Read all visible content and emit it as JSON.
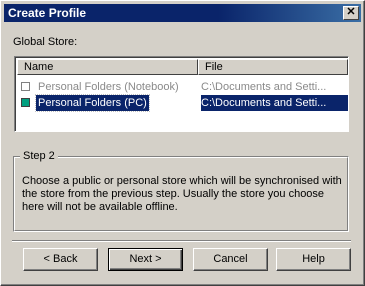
{
  "window": {
    "title": "Create Profile",
    "close_glyph": "✕"
  },
  "global_store_label": "Global Store:",
  "list": {
    "columns": [
      "Name",
      "File"
    ],
    "rows": [
      {
        "name": "Personal Folders (Notebook)",
        "file": "C:\\Documents and Setti...",
        "state": "disabled",
        "icon_color": "#ffffff"
      },
      {
        "name": "Personal Folders (PC)",
        "file": "C:\\Documents and Setti...",
        "state": "selected",
        "icon_color": "#00a080"
      }
    ]
  },
  "step": {
    "title": "Step 2",
    "description": "Choose a public or personal store which will be synchronised with the store from the previous step. Usually the store you choose here will not be available offline."
  },
  "buttons": {
    "back": "< Back",
    "next": "Next >",
    "cancel": "Cancel",
    "help": "Help"
  },
  "colors": {
    "titlebar": "#0a246a",
    "selection": "#0a246a",
    "face": "#d4d0c8"
  }
}
